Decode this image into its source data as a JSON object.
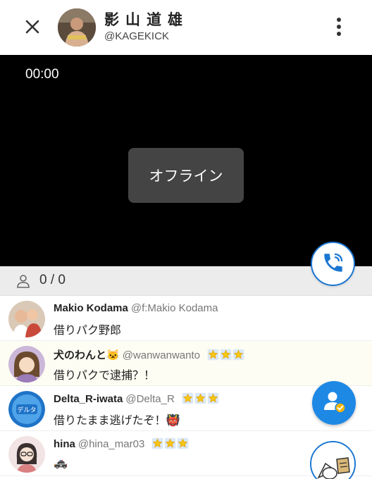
{
  "header": {
    "name": "影山道雄",
    "handle": "@KAGEKICK"
  },
  "video": {
    "timer": "00:00",
    "status": "オフライン"
  },
  "viewers": {
    "count": "0 / 0"
  },
  "comments": [
    {
      "name": "Makio Kodama",
      "handle": "@f:Makio Kodama",
      "text": "借りパク野郎",
      "stars": 0
    },
    {
      "name": "犬のわんと🐱",
      "handle": "@wanwanwanto",
      "text": "借りパクで逮捕？！",
      "stars": 3
    },
    {
      "name": "Delta_R-iwata",
      "handle": "@Delta_R",
      "text": "借りたまま逃げたぞ！👹",
      "stars": 3
    },
    {
      "name": "hina",
      "handle": "@hina_mar03",
      "text": "🚓",
      "stars": 3
    }
  ],
  "colors": {
    "accent": "#1976d2",
    "fab_blue": "#1e88e5",
    "star": "#f5c518"
  },
  "icons": [
    "close-icon",
    "more-vert-icon",
    "phone-call-icon",
    "person-outline-icon",
    "star-icon",
    "profile-check-icon"
  ]
}
